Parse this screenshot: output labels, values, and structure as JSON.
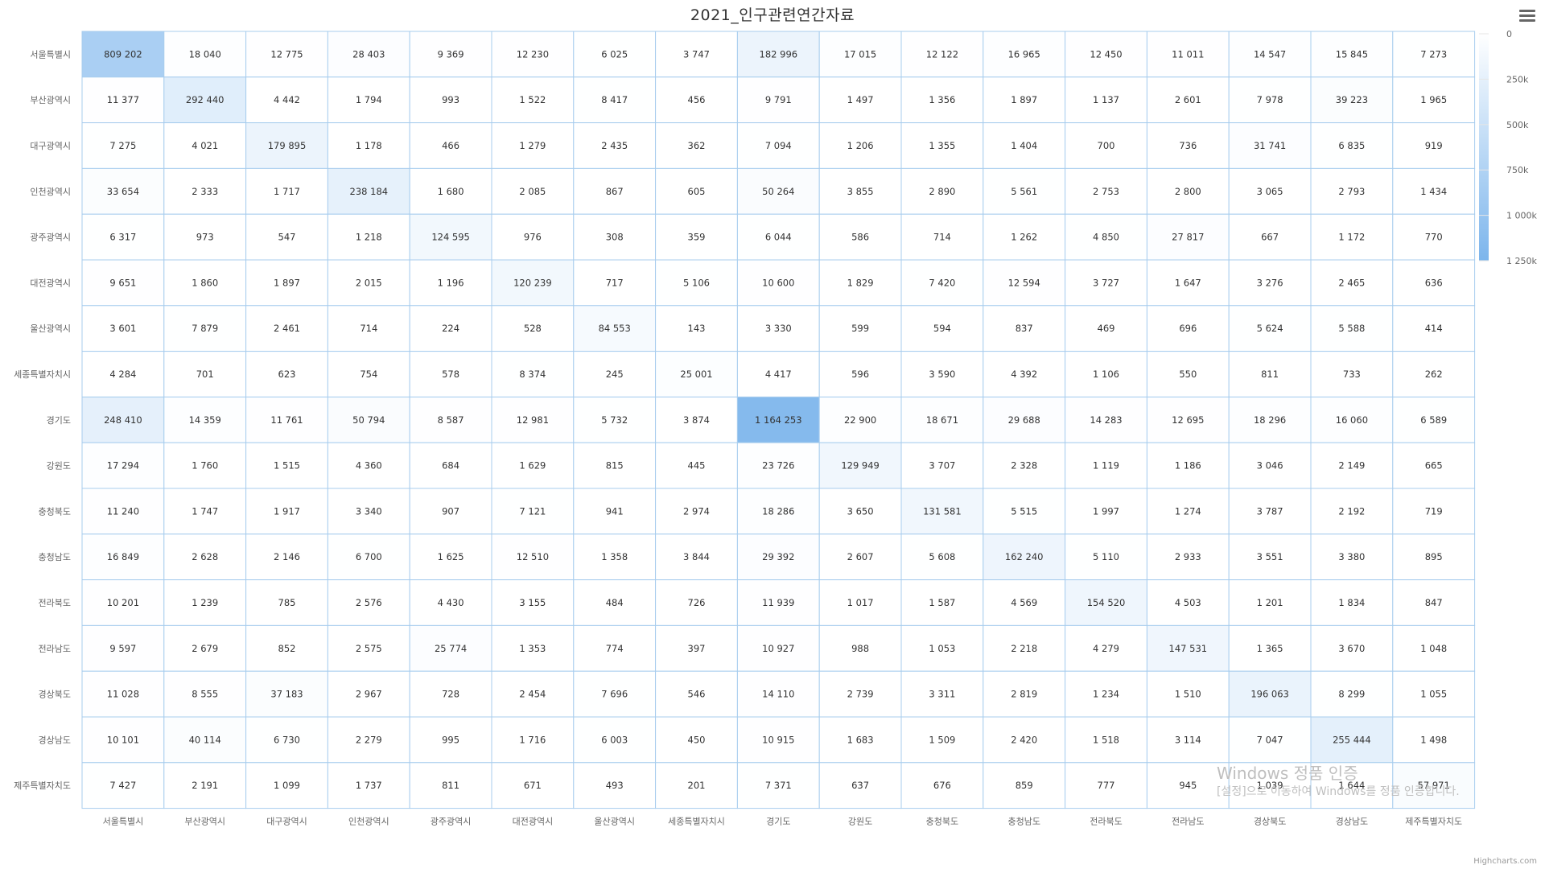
{
  "title": "2021_인구관련연간자료",
  "credits": "Highcharts.com",
  "menu_icon": "hamburger-menu-icon",
  "watermark": {
    "line1": "Windows 정품 인증",
    "line2": "[설정]으로 이동하여 Windows를 정품 인증합니다."
  },
  "colors": {
    "min": "#ffffff",
    "max": "#7cb5ec",
    "grid": "#a8cdee",
    "label": "#333333",
    "axis_label": "#666666"
  },
  "chart_data": {
    "type": "heatmap",
    "title": "2021_인구관련연간자료",
    "x_categories": [
      "서울특별시",
      "부산광역시",
      "대구광역시",
      "인천광역시",
      "광주광역시",
      "대전광역시",
      "울산광역시",
      "세종특별자치시",
      "경기도",
      "강원도",
      "충청북도",
      "충청남도",
      "전라북도",
      "전라남도",
      "경상북도",
      "경상남도",
      "제주특별자치도"
    ],
    "y_categories": [
      "서울특별시",
      "부산광역시",
      "대구광역시",
      "인천광역시",
      "광주광역시",
      "대전광역시",
      "울산광역시",
      "세종특별자치시",
      "경기도",
      "강원도",
      "충청북도",
      "충청남도",
      "전라북도",
      "전라남도",
      "경상북도",
      "경상남도",
      "제주특별자치도"
    ],
    "values": [
      [
        809202,
        18040,
        12775,
        28403,
        9369,
        12230,
        6025,
        3747,
        182996,
        17015,
        12122,
        16965,
        12450,
        11011,
        14547,
        15845,
        7273
      ],
      [
        11377,
        292440,
        4442,
        1794,
        993,
        1522,
        8417,
        456,
        9791,
        1497,
        1356,
        1897,
        1137,
        2601,
        7978,
        39223,
        1965
      ],
      [
        7275,
        4021,
        179895,
        1178,
        466,
        1279,
        2435,
        362,
        7094,
        1206,
        1355,
        1404,
        700,
        736,
        31741,
        6835,
        919
      ],
      [
        33654,
        2333,
        1717,
        238184,
        1680,
        2085,
        867,
        605,
        50264,
        3855,
        2890,
        5561,
        2753,
        2800,
        3065,
        2793,
        1434
      ],
      [
        6317,
        973,
        547,
        1218,
        124595,
        976,
        308,
        359,
        6044,
        586,
        714,
        1262,
        4850,
        27817,
        667,
        1172,
        770
      ],
      [
        9651,
        1860,
        1897,
        2015,
        1196,
        120239,
        717,
        5106,
        10600,
        1829,
        7420,
        12594,
        3727,
        1647,
        3276,
        2465,
        636
      ],
      [
        3601,
        7879,
        2461,
        714,
        224,
        528,
        84553,
        143,
        3330,
        599,
        594,
        837,
        469,
        696,
        5624,
        5588,
        414
      ],
      [
        4284,
        701,
        623,
        754,
        578,
        8374,
        245,
        25001,
        4417,
        596,
        3590,
        4392,
        1106,
        550,
        811,
        733,
        262
      ],
      [
        248410,
        14359,
        11761,
        50794,
        8587,
        12981,
        5732,
        3874,
        1164253,
        22900,
        18671,
        29688,
        14283,
        12695,
        18296,
        16060,
        6589
      ],
      [
        17294,
        1760,
        1515,
        4360,
        684,
        1629,
        815,
        445,
        23726,
        129949,
        3707,
        2328,
        1119,
        1186,
        3046,
        2149,
        665
      ],
      [
        11240,
        1747,
        1917,
        3340,
        907,
        7121,
        941,
        2974,
        18286,
        3650,
        131581,
        5515,
        1997,
        1274,
        3787,
        2192,
        719
      ],
      [
        16849,
        2628,
        2146,
        6700,
        1625,
        12510,
        1358,
        3844,
        29392,
        2607,
        5608,
        162240,
        5110,
        2933,
        3551,
        3380,
        895
      ],
      [
        10201,
        1239,
        785,
        2576,
        4430,
        3155,
        484,
        726,
        11939,
        1017,
        1587,
        4569,
        154520,
        4503,
        1201,
        1834,
        847
      ],
      [
        9597,
        2679,
        852,
        2575,
        25774,
        1353,
        774,
        397,
        10927,
        988,
        1053,
        2218,
        4279,
        147531,
        1365,
        3670,
        1048
      ],
      [
        11028,
        8555,
        37183,
        2967,
        728,
        2454,
        7696,
        546,
        14110,
        2739,
        3311,
        2819,
        1234,
        1510,
        196063,
        8299,
        1055
      ],
      [
        10101,
        40114,
        6730,
        2279,
        995,
        1716,
        6003,
        450,
        10915,
        1683,
        1509,
        2420,
        1518,
        3114,
        7047,
        255444,
        1498
      ],
      [
        7427,
        2191,
        1099,
        1737,
        811,
        671,
        493,
        201,
        7371,
        637,
        676,
        859,
        777,
        945,
        1039,
        1644,
        57971
      ]
    ],
    "color_axis": {
      "min": 0,
      "max": 1250000,
      "tick_labels": [
        "0",
        "250k",
        "500k",
        "750k",
        "1 000k",
        "1 250k"
      ],
      "tick_values": [
        0,
        250000,
        500000,
        750000,
        1000000,
        1250000
      ]
    },
    "grid": true,
    "legend": "right-vertical"
  }
}
